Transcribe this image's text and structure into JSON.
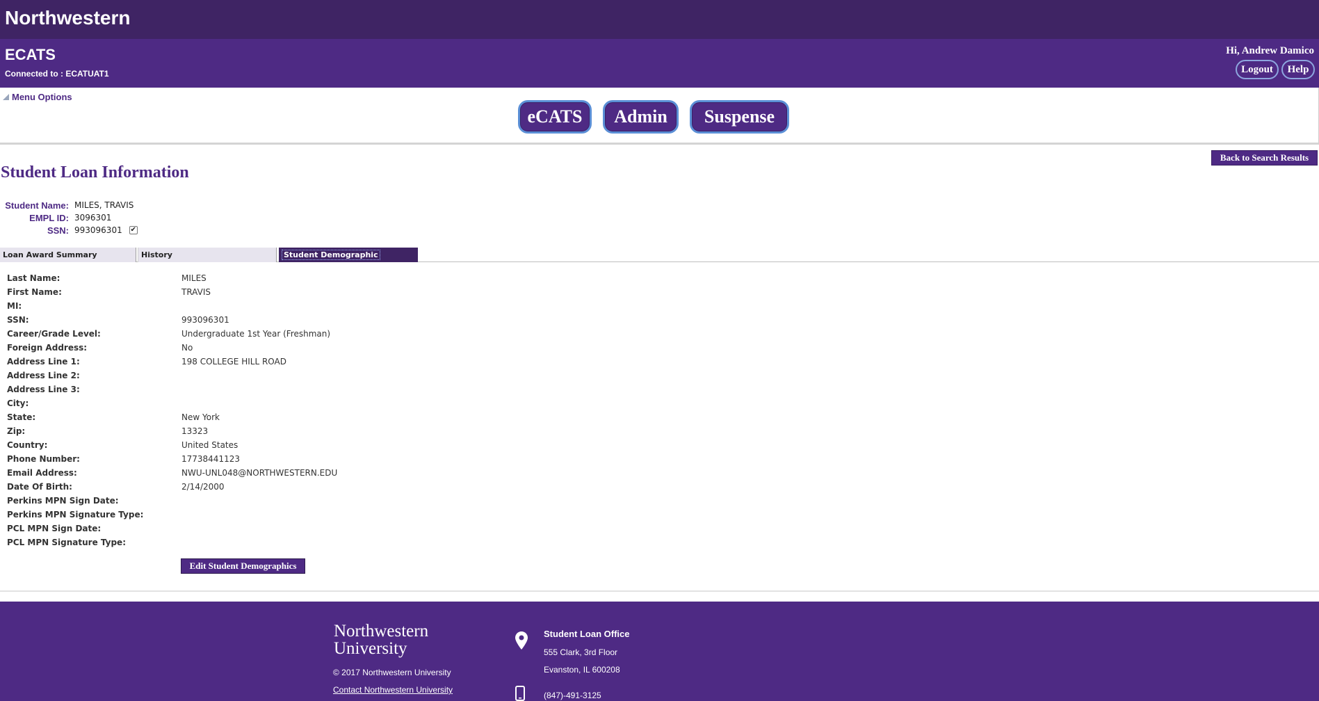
{
  "brand": {
    "name": "Northwestern"
  },
  "header": {
    "app_title": "ECATS",
    "connected": "Connected to : ECATUAT1",
    "greeting": "Hi, Andrew Damico",
    "logout_label": "Logout",
    "help_label": "Help"
  },
  "menu": {
    "menu_options_label": "Menu Options",
    "nav": [
      "eCATS",
      "Admin",
      "Suspense"
    ]
  },
  "page": {
    "back_label": "Back to Search Results",
    "title": "Student Loan Information"
  },
  "student": {
    "name_label": "Student Name:",
    "name": "MILES, TRAVIS",
    "empl_label": "EMPL ID:",
    "empl": "3096301",
    "ssn_label": "SSN:",
    "ssn": "993096301",
    "ssn_checked": true
  },
  "tabs": [
    "Loan Award Summary",
    "History",
    "Student Demographic"
  ],
  "demographics": [
    {
      "label": "Last Name:",
      "value": "MILES"
    },
    {
      "label": "First Name:",
      "value": "TRAVIS"
    },
    {
      "label": "MI:",
      "value": ""
    },
    {
      "label": "SSN:",
      "value": "993096301"
    },
    {
      "label": "Career/Grade Level:",
      "value": "Undergraduate 1st Year (Freshman)"
    },
    {
      "label": "Foreign Address:",
      "value": "No"
    },
    {
      "label": "Address Line 1:",
      "value": "198 COLLEGE HILL ROAD"
    },
    {
      "label": "Address Line 2:",
      "value": ""
    },
    {
      "label": "Address Line 3:",
      "value": ""
    },
    {
      "label": "City:",
      "value": ""
    },
    {
      "label": "State:",
      "value": "New York"
    },
    {
      "label": "Zip:",
      "value": "13323"
    },
    {
      "label": "Country:",
      "value": "United States"
    },
    {
      "label": "Phone Number:",
      "value": "17738441123"
    },
    {
      "label": "Email Address:",
      "value": "NWU-UNL048@NORTHWESTERN.EDU"
    },
    {
      "label": "Date Of Birth:",
      "value": "2/14/2000"
    },
    {
      "label": "Perkins MPN Sign Date:",
      "value": ""
    },
    {
      "label": "Perkins MPN Signature Type:",
      "value": ""
    },
    {
      "label": "PCL MPN Sign Date:",
      "value": ""
    },
    {
      "label": "PCL MPN Signature Type:",
      "value": ""
    }
  ],
  "edit_label": "Edit Student Demographics",
  "footer": {
    "logo_line1": "Northwestern",
    "logo_line2": "University",
    "copyright": "© 2017 Northwestern University",
    "contact_link": "Contact Northwestern University",
    "office_name": "Student Loan Office",
    "address1": "555 Clark, 3rd Floor",
    "address2": "Evanston, IL 600208",
    "phone": "(847)-491-3125",
    "icons": [
      "location-pin-icon",
      "phone-icon"
    ]
  },
  "colors": {
    "brand_dark": "#3f2464",
    "brand": "#4e2a84",
    "button_border": "#5b8fd6"
  }
}
